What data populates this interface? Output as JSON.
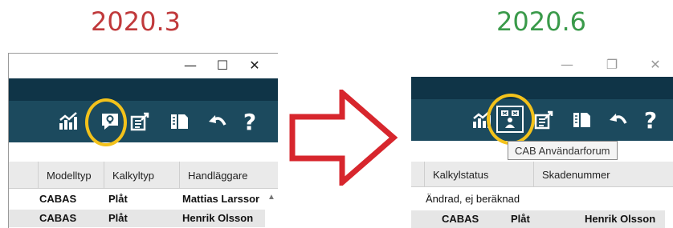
{
  "versions": {
    "left": "2020.3",
    "right": "2020.6"
  },
  "window_controls": {
    "minimize": "—",
    "maximize": "☐",
    "restore": "❐",
    "close": "✕"
  },
  "toolbar": {
    "icons_old": [
      "chart-icon",
      "forum-bubble-icon",
      "edit-export-icon",
      "book-icon",
      "undo-arrow-icon",
      "help-icon"
    ],
    "icons_new": [
      "chart-icon",
      "cab-forum-icon",
      "edit-export-icon",
      "book-icon",
      "undo-arrow-icon",
      "help-icon"
    ],
    "help_label": "?"
  },
  "tooltip": "CAB Användarforum",
  "old_table": {
    "columns": [
      "Modelltyp",
      "Kalkyltyp",
      "Handläggare"
    ],
    "rows": [
      [
        "CABAS",
        "Plåt",
        "Mattias Larssor"
      ],
      [
        "CABAS",
        "Plåt",
        "Henrik Olsson"
      ]
    ]
  },
  "new_table": {
    "columns": [
      "Kalkylstatus",
      "Skadenummer"
    ],
    "status": "Ändrad, ej beräknad",
    "rows": [
      [
        "CABAS",
        "Plåt",
        "Henrik Olsson"
      ]
    ]
  },
  "colors": {
    "toolbar": "#1c4a5e",
    "toolbar_top": "#0f3447",
    "highlight": "#f3c21b",
    "arrow": "#d7262d",
    "version_left": "#c0393b",
    "version_right": "#3a9a4a"
  }
}
